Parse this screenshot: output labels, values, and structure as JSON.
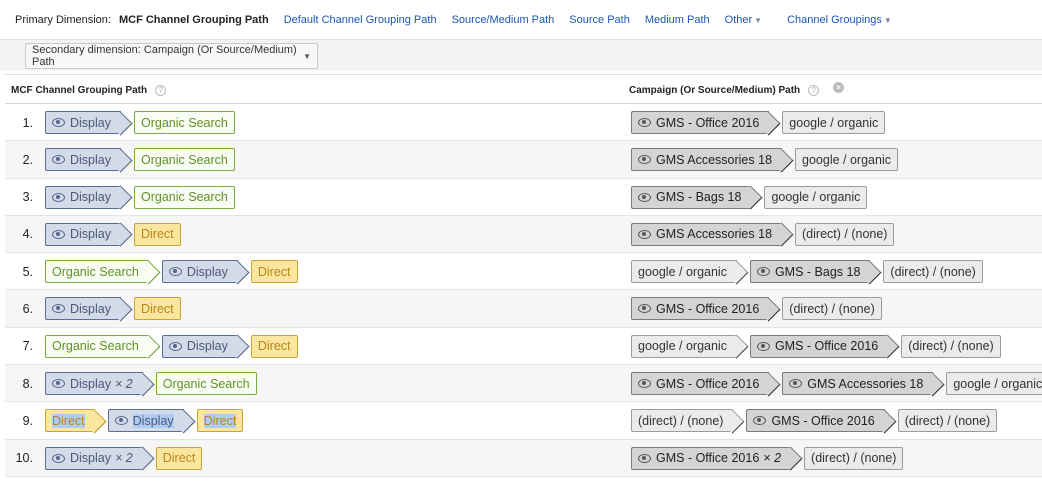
{
  "topbar": {
    "primary_label": "Primary Dimension:",
    "current": "MCF Channel Grouping Path",
    "links": [
      "Default Channel Grouping Path",
      "Source/Medium Path",
      "Source Path",
      "Medium Path"
    ],
    "other": "Other",
    "channel_groupings": "Channel Groupings"
  },
  "secondary": {
    "label": "Secondary dimension: Campaign (Or Source/Medium) Path"
  },
  "table": {
    "col1": "MCF Channel Grouping Path",
    "col2": "Campaign (Or Source/Medium) Path",
    "help": "?",
    "close": "×",
    "rows": [
      {
        "n": "1.",
        "path": [
          {
            "t": "display",
            "l": "Display"
          },
          {
            "t": "organic",
            "l": "Organic Search"
          }
        ],
        "camp": [
          {
            "t": "gms",
            "l": "GMS - Office 2016"
          },
          {
            "t": "plain",
            "l": "google / organic"
          }
        ]
      },
      {
        "n": "2.",
        "path": [
          {
            "t": "display",
            "l": "Display"
          },
          {
            "t": "organic",
            "l": "Organic Search"
          }
        ],
        "camp": [
          {
            "t": "gms",
            "l": "GMS Accessories 18"
          },
          {
            "t": "plain",
            "l": "google / organic"
          }
        ]
      },
      {
        "n": "3.",
        "path": [
          {
            "t": "display",
            "l": "Display"
          },
          {
            "t": "organic",
            "l": "Organic Search"
          }
        ],
        "camp": [
          {
            "t": "gms",
            "l": "GMS - Bags 18"
          },
          {
            "t": "plain",
            "l": "google / organic"
          }
        ]
      },
      {
        "n": "4.",
        "path": [
          {
            "t": "display",
            "l": "Display"
          },
          {
            "t": "direct",
            "l": "Direct"
          }
        ],
        "camp": [
          {
            "t": "gms",
            "l": "GMS Accessories 18"
          },
          {
            "t": "plain",
            "l": "(direct) / (none)"
          }
        ]
      },
      {
        "n": "5.",
        "path": [
          {
            "t": "organic",
            "l": "Organic Search"
          },
          {
            "t": "display",
            "l": "Display"
          },
          {
            "t": "direct",
            "l": "Direct"
          }
        ],
        "camp": [
          {
            "t": "plain",
            "l": "google / organic"
          },
          {
            "t": "gms",
            "l": "GMS - Bags 18"
          },
          {
            "t": "plain",
            "l": "(direct) / (none)"
          }
        ]
      },
      {
        "n": "6.",
        "path": [
          {
            "t": "display",
            "l": "Display"
          },
          {
            "t": "direct",
            "l": "Direct"
          }
        ],
        "camp": [
          {
            "t": "gms",
            "l": "GMS - Office 2016"
          },
          {
            "t": "plain",
            "l": "(direct) / (none)"
          }
        ]
      },
      {
        "n": "7.",
        "path": [
          {
            "t": "organic",
            "l": "Organic Search"
          },
          {
            "t": "display",
            "l": "Display"
          },
          {
            "t": "direct",
            "l": "Direct"
          }
        ],
        "camp": [
          {
            "t": "plain",
            "l": "google / organic"
          },
          {
            "t": "gms",
            "l": "GMS - Office 2016"
          },
          {
            "t": "plain",
            "l": "(direct) / (none)"
          }
        ]
      },
      {
        "n": "8.",
        "path": [
          {
            "t": "display",
            "l": "Display",
            "m": "× 2"
          },
          {
            "t": "organic",
            "l": "Organic Search"
          }
        ],
        "camp": [
          {
            "t": "gms",
            "l": "GMS - Office 2016"
          },
          {
            "t": "gms",
            "l": "GMS Accessories 18"
          },
          {
            "t": "plain",
            "l": "google / organic"
          }
        ]
      },
      {
        "n": "9.",
        "path": [
          {
            "t": "direct",
            "l": "Direct",
            "sel": true
          },
          {
            "t": "display",
            "l": "Display",
            "sel": true
          },
          {
            "t": "direct",
            "l": "Direct",
            "sel": true
          }
        ],
        "camp": [
          {
            "t": "plain",
            "l": "(direct) / (none)"
          },
          {
            "t": "gms",
            "l": "GMS - Office 2016"
          },
          {
            "t": "plain",
            "l": "(direct) / (none)"
          }
        ]
      },
      {
        "n": "10.",
        "path": [
          {
            "t": "display",
            "l": "Display",
            "m": "× 2"
          },
          {
            "t": "direct",
            "l": "Direct"
          }
        ],
        "camp": [
          {
            "t": "gms",
            "l": "GMS - Office 2016",
            "m": "× 2"
          },
          {
            "t": "plain",
            "l": "(direct) / (none)"
          }
        ]
      }
    ]
  }
}
